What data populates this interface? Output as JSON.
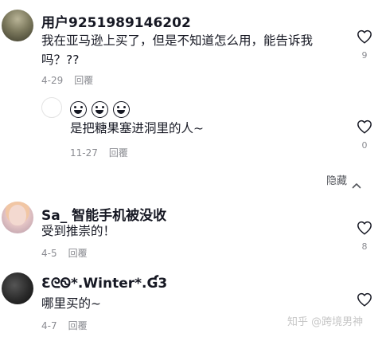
{
  "comments": [
    {
      "username": "用户9251989146202",
      "text_line1": "我在亚马逊上买了，但是不知道怎么用，能告诉我",
      "text_line2": "吗？??",
      "date": "4-29",
      "reply_label": "回覆",
      "likes": "9"
    },
    {
      "text": "是把糖果塞进洞里的人~",
      "date": "11-27",
      "reply_label": "回覆",
      "likes": "0",
      "emoji_icon": "grinning-face-icon"
    },
    {
      "username": "Sa_ 智能手机被没收",
      "text": "受到推崇的！",
      "date": "4-5",
      "reply_label": "回覆",
      "likes": "8"
    },
    {
      "username": "ƐᘓᏫ*.Winter*.Ɠ3",
      "text": "哪里买的~",
      "date": "4-7",
      "reply_label": "回覆",
      "likes": ""
    }
  ],
  "hide_label": "隐藏",
  "watermark": "知乎 @跨境男神",
  "icons": {
    "like": "heart-outline-icon",
    "collapse": "chevron-up-icon"
  },
  "colors": {
    "text": "#161823",
    "muted": "#8a8b91",
    "background": "#ffffff"
  }
}
